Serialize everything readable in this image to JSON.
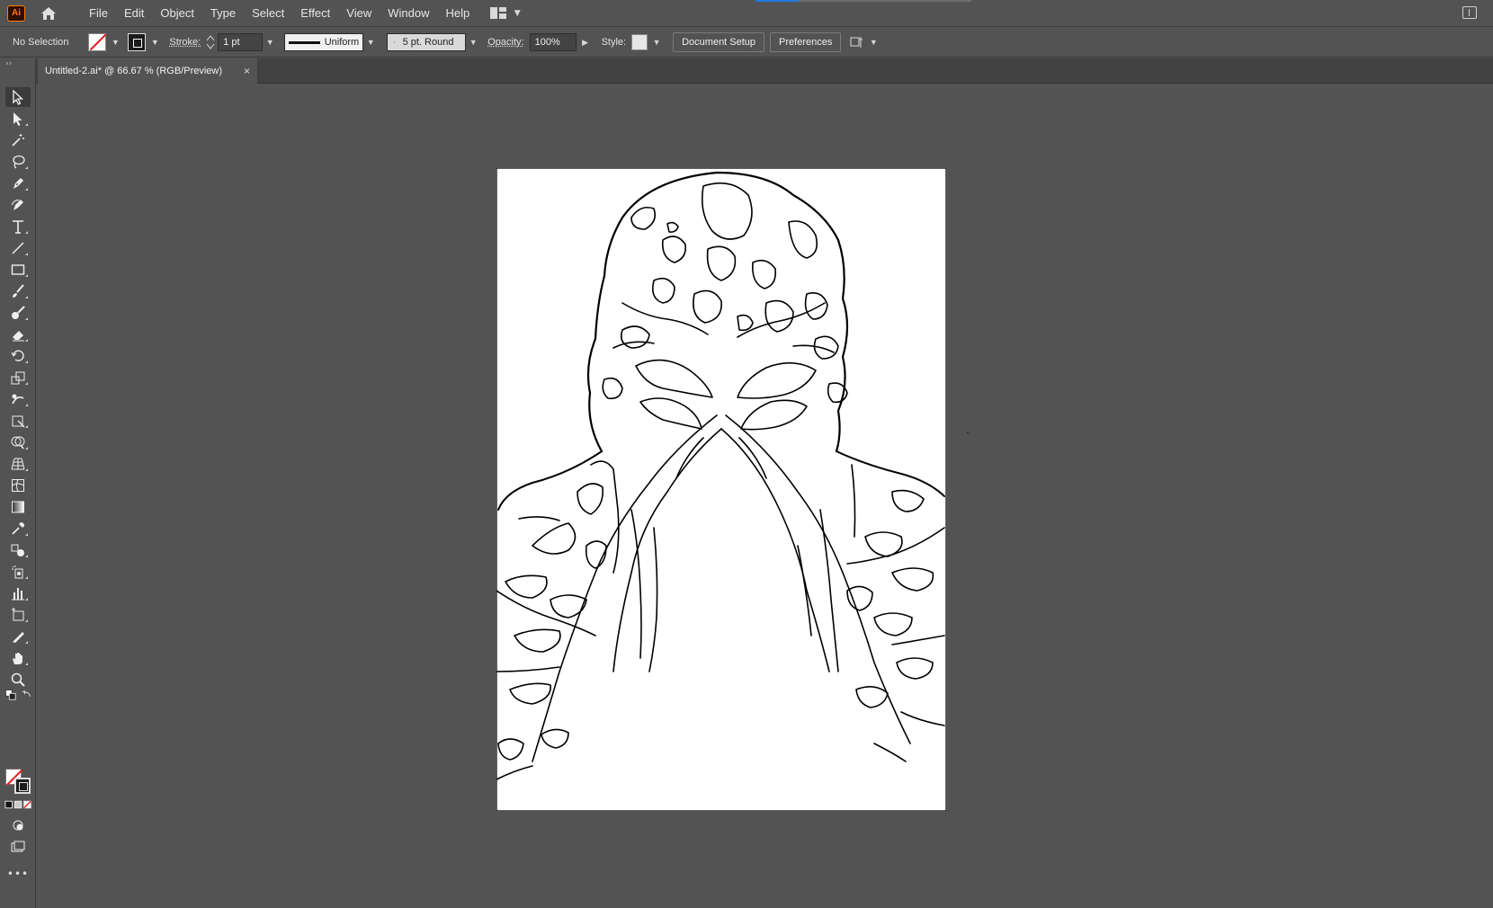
{
  "app": {
    "logo_text": "Ai",
    "menu": [
      "File",
      "Edit",
      "Object",
      "Type",
      "Select",
      "Effect",
      "View",
      "Window",
      "Help"
    ]
  },
  "controlbar": {
    "selection_status": "No Selection",
    "stroke_label": "Stroke:",
    "stroke_weight": "1 pt",
    "variable_width_profile": "Uniform",
    "brush_definition": "5 pt. Round",
    "opacity_label": "Opacity:",
    "opacity_value": "100%",
    "style_label": "Style:",
    "document_setup_label": "Document Setup",
    "preferences_label": "Preferences"
  },
  "document_tab": {
    "title": "Untitled-2.ai* @ 66.67 % (RGB/Preview)",
    "close_glyph": "×"
  },
  "toolbar": {
    "tools": [
      "selection-tool",
      "direct-selection-tool",
      "magic-wand-tool",
      "lasso-tool",
      "pen-tool",
      "curvature-tool",
      "type-tool",
      "line-segment-tool",
      "rectangle-tool",
      "paintbrush-tool",
      "blob-brush-tool",
      "eraser-tool",
      "rotate-tool",
      "scale-tool",
      "warp-tool",
      "free-transform-tool",
      "shape-builder-tool",
      "perspective-grid-tool",
      "mesh-tool",
      "gradient-tool",
      "eyedropper-tool",
      "blend-tool",
      "symbol-sprayer-tool",
      "column-graph-tool",
      "artboard-tool",
      "slice-tool",
      "hand-tool",
      "zoom-tool"
    ],
    "more_glyph": "•••"
  },
  "colors": {
    "ui_bg": "#535353",
    "tab_strip": "#424242",
    "artboard": "#ffffff",
    "accent": "#1f7ae0",
    "none_slash": "#e02020",
    "logo_orange": "#ff7c00"
  }
}
